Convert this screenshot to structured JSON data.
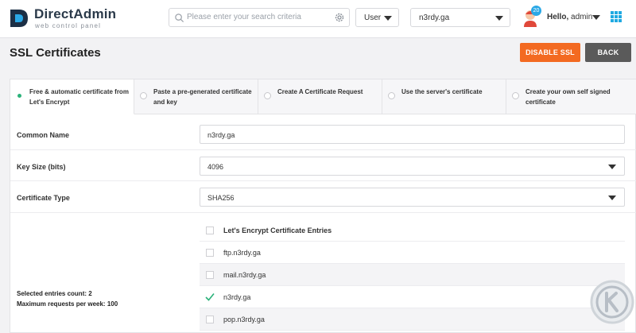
{
  "brand": {
    "name": "DirectAdmin",
    "tagline": "web control panel",
    "logo_icon": "directadmin-logo-icon"
  },
  "search": {
    "placeholder": "Please enter your search criteria",
    "icon": "search-icon",
    "settings_icon": "gear-icon"
  },
  "user_menu": {
    "role_selected": "User",
    "domain_selected": "n3rdy.ga",
    "notifications_count": "20",
    "greeting": "Hello,",
    "username": "admin",
    "apps_icon": "grid-icon"
  },
  "page": {
    "title": "SSL Certificates",
    "disable_ssl_label": "DISABLE SSL",
    "back_label": "BACK"
  },
  "tabs": [
    {
      "label": "Free & automatic certificate from Let's Encrypt",
      "selected": true
    },
    {
      "label": "Paste a pre-generated certificate and key",
      "selected": false
    },
    {
      "label": "Create A Certificate Request",
      "selected": false
    },
    {
      "label": "Use the server's certificate",
      "selected": false
    },
    {
      "label": "Create your own self signed certificate",
      "selected": false
    }
  ],
  "form": {
    "common_name": {
      "label": "Common Name",
      "value": "n3rdy.ga"
    },
    "key_size": {
      "label": "Key Size (bits)",
      "value": "4096"
    },
    "certificate_type": {
      "label": "Certificate Type",
      "value": "SHA256"
    }
  },
  "entries": {
    "header": "Let's Encrypt Certificate Entries",
    "items": [
      {
        "label": "ftp.n3rdy.ga",
        "checked": false
      },
      {
        "label": "mail.n3rdy.ga",
        "checked": false
      },
      {
        "label": "n3rdy.ga",
        "checked": true
      },
      {
        "label": "pop.n3rdy.ga",
        "checked": false
      }
    ],
    "selected_count_text": "Selected entries count: 2",
    "max_requests_text": "Maximum requests per week: 100"
  },
  "colors": {
    "accent_orange": "#f36a21",
    "back_gray": "#5a5a5a",
    "check_green": "#2bb27a",
    "brand_blue": "#1fa9e1"
  }
}
